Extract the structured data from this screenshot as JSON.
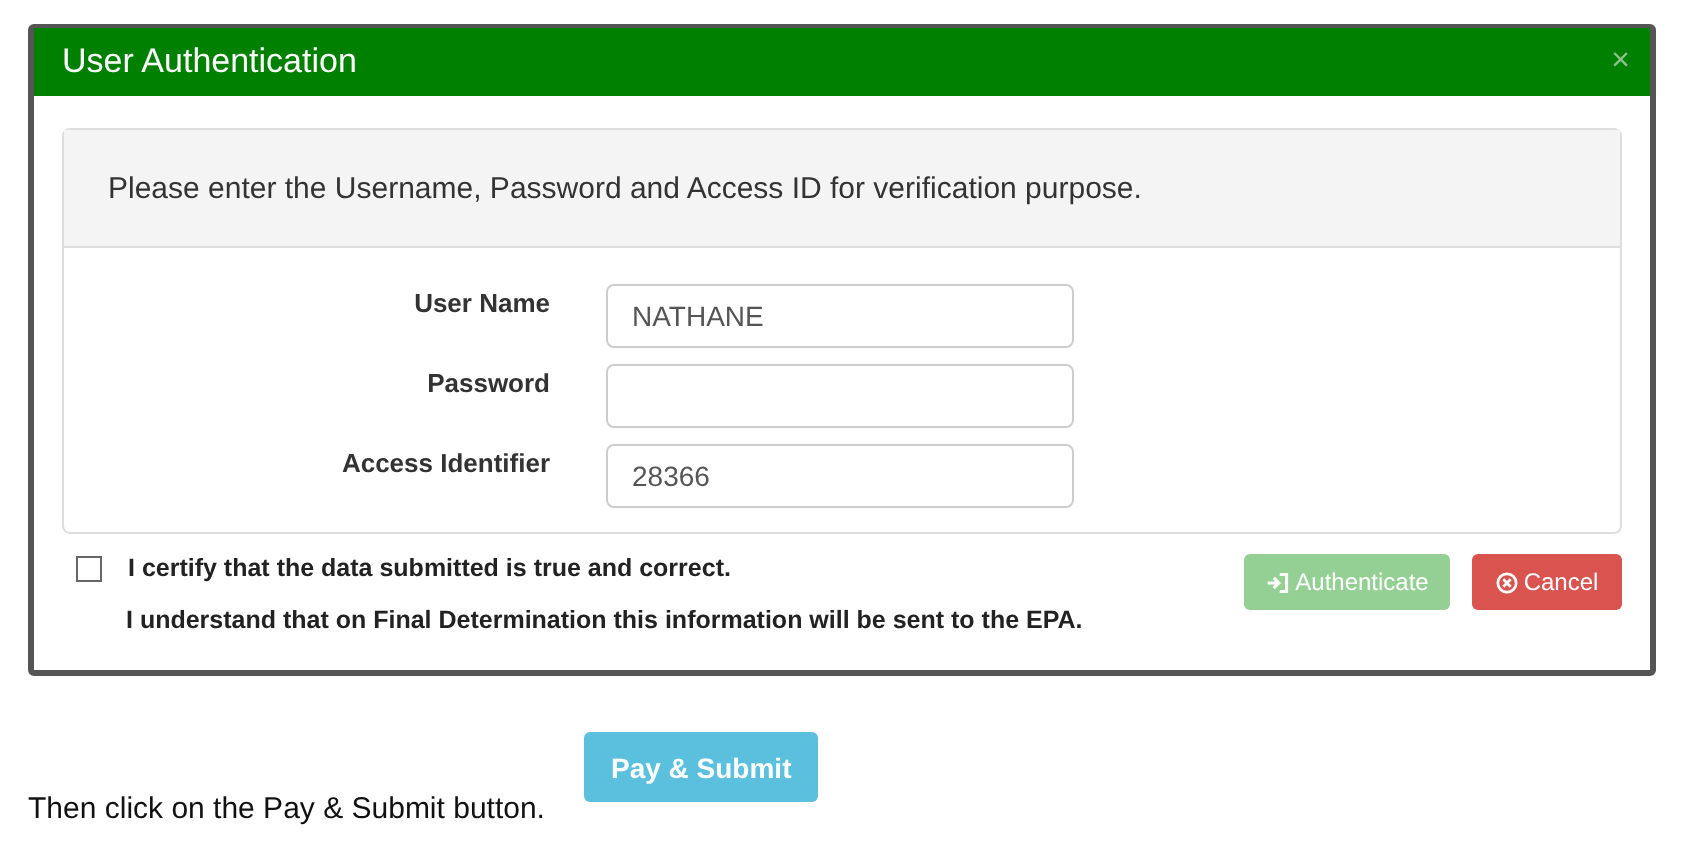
{
  "dialog": {
    "title": "User Authentication",
    "close": "×",
    "intro": "Please enter the Username, Password and Access ID for verification purpose.",
    "fields": [
      {
        "label": "User Name",
        "value": "NATHANE"
      },
      {
        "label": "Password"
      },
      {
        "label": "Access Identifier",
        "value": "28366"
      }
    ],
    "certify": {
      "label": "I certify that the data submitted is true and correct.",
      "checked": false
    },
    "note": "I understand that on Final Determination this information will be sent to the EPA.",
    "buttons": [
      {
        "kind": "authenticate",
        "label": "Authenticate",
        "disabled": true
      },
      {
        "kind": "cancel",
        "label": "Cancel",
        "disabled": false
      }
    ]
  },
  "instruction": "Then click on the Pay & Submit button.",
  "pay_button": {
    "label": "Pay & Submit"
  }
}
